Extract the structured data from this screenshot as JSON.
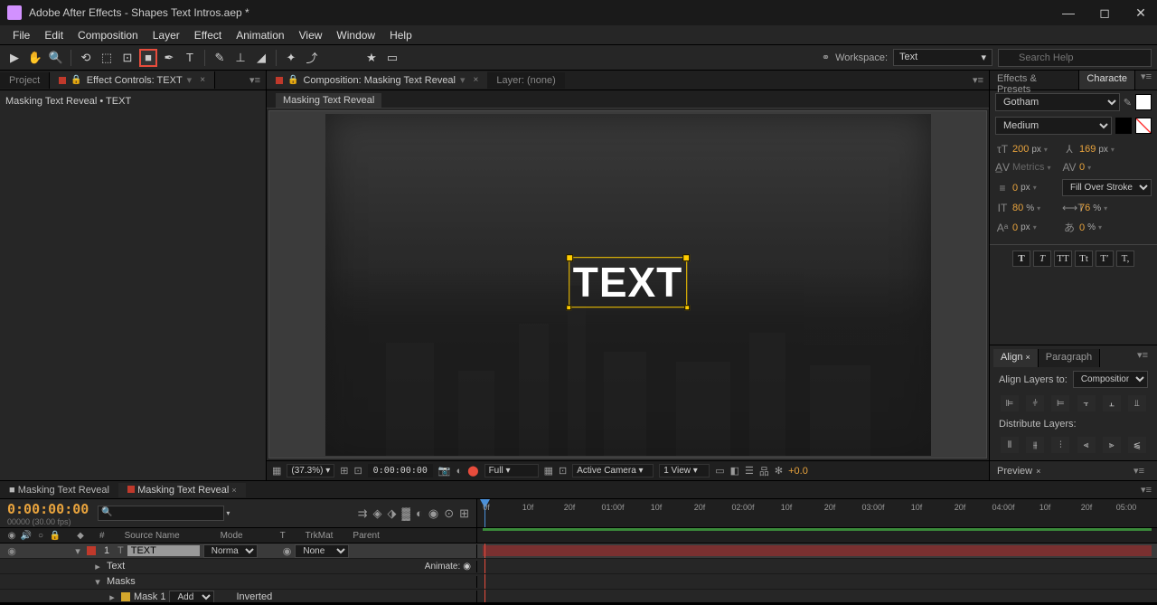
{
  "title": "Adobe After Effects - Shapes Text Intros.aep *",
  "menu": [
    "File",
    "Edit",
    "Composition",
    "Layer",
    "Effect",
    "Animation",
    "View",
    "Window",
    "Help"
  ],
  "workspace": {
    "label": "Workspace:",
    "value": "Text"
  },
  "search": {
    "placeholder": "Search Help"
  },
  "left_panel": {
    "tabs": {
      "project": "Project",
      "effect_controls": "Effect Controls: TEXT"
    },
    "content": "Masking Text Reveal • TEXT"
  },
  "center": {
    "tab_comp": "Composition: Masking Text Reveal",
    "tab_layer": "Layer: (none)",
    "breadcrumb": "Masking Text Reveal",
    "canvas_text": "TEXT",
    "controls": {
      "zoom": "(37.3%)",
      "timecode": "0:00:00:00",
      "resolution": "Full",
      "camera": "Active Camera",
      "view": "1 View",
      "exposure": "+0.0"
    }
  },
  "right": {
    "tabs": {
      "effects": "Effects & Presets",
      "character": "Characte"
    },
    "font": "Gotham",
    "weight": "Medium",
    "size": {
      "v": "200",
      "u": "px"
    },
    "leading": {
      "v": "169",
      "u": "px"
    },
    "kerning": "Metrics",
    "tracking": {
      "v": "0"
    },
    "stroke": {
      "v": "0",
      "u": "px"
    },
    "stroke_opt": "Fill Over Stroke",
    "vscale": {
      "v": "80",
      "u": "%"
    },
    "hscale": {
      "v": "76",
      "u": "%"
    },
    "baseline": {
      "v": "0",
      "u": "px"
    },
    "tsume": {
      "v": "0",
      "u": "%"
    },
    "styles": [
      "T",
      "T",
      "TT",
      "Tt",
      "T′",
      "T,"
    ],
    "align": {
      "tab1": "Align",
      "tab2": "Paragraph",
      "label": "Align Layers to:",
      "target": "Composition",
      "distribute": "Distribute Layers:"
    },
    "preview": "Preview"
  },
  "timeline": {
    "tab1": "Masking Text Reveal",
    "tab2": "Masking Text Reveal",
    "timecode": "0:00:00:00",
    "fps": "00000 (30.00 fps)",
    "ticks": [
      "0f",
      "10f",
      "20f",
      "01:00f",
      "10f",
      "20f",
      "02:00f",
      "10f",
      "20f",
      "03:00f",
      "10f",
      "20f",
      "04:00f",
      "10f",
      "20f",
      "05:00"
    ],
    "cols": {
      "num": "#",
      "source": "Source Name",
      "mode": "Mode",
      "t": "T",
      "trkmat": "TrkMat",
      "parent": "Parent"
    },
    "row1": {
      "num": "1",
      "name": "TEXT",
      "mode": "Normal",
      "trkmat": "None"
    },
    "row2": {
      "name": "Text",
      "animate": "Animate:"
    },
    "row3": {
      "name": "Masks"
    },
    "row4": {
      "name": "Mask 1",
      "add": "Add",
      "inverted": "Inverted"
    }
  }
}
